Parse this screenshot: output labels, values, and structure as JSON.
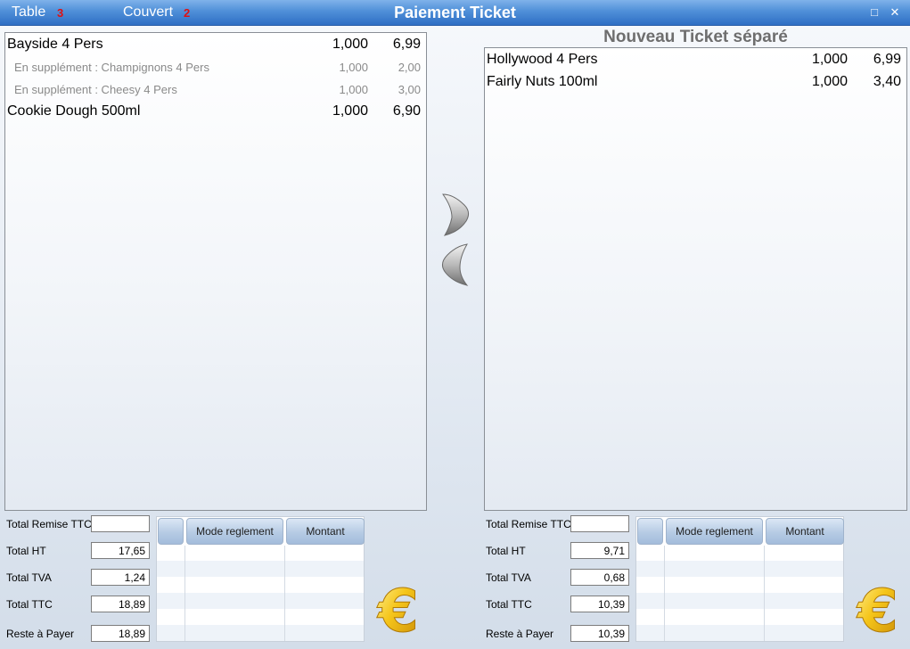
{
  "window": {
    "title": "Paiement Ticket",
    "table_label": "Table",
    "table_value": "3",
    "couvert_label": "Couvert",
    "couvert_value": "2",
    "maximize_glyph": "□",
    "close_glyph": "✕"
  },
  "left_ticket": {
    "items": [
      {
        "name": "Bayside 4 Pers",
        "qty": "1,000",
        "price": "6,99",
        "kind": "main"
      },
      {
        "name": "En supplément : Champignons 4 Pers",
        "qty": "1,000",
        "price": "2,00",
        "kind": "sub"
      },
      {
        "name": "En supplément : Cheesy 4 Pers",
        "qty": "1,000",
        "price": "3,00",
        "kind": "sub"
      },
      {
        "name": "Cookie Dough 500ml",
        "qty": "1,000",
        "price": "6,90",
        "kind": "main"
      }
    ],
    "totals": {
      "remise_label": "Total Remise TTC",
      "remise_value": "",
      "ht_label": "Total HT",
      "ht_value": "17,65",
      "tva_label": "Total TVA",
      "tva_value": "1,24",
      "ttc_label": "Total TTC",
      "ttc_value": "18,89",
      "reste_label": "Reste à Payer",
      "reste_value": "18,89"
    },
    "grid": {
      "col1": "",
      "col2": "Mode reglement",
      "col3": "Montant"
    }
  },
  "right_ticket": {
    "title": "Nouveau Ticket séparé",
    "items": [
      {
        "name": "Hollywood 4 Pers",
        "qty": "1,000",
        "price": "6,99",
        "kind": "main"
      },
      {
        "name": "Fairly Nuts 100ml",
        "qty": "1,000",
        "price": "3,40",
        "kind": "main"
      }
    ],
    "totals": {
      "remise_label": "Total Remise TTC",
      "remise_value": "",
      "ht_label": "Total HT",
      "ht_value": "9,71",
      "tva_label": "Total TVA",
      "tva_value": "0,68",
      "ttc_label": "Total TTC",
      "ttc_value": "10,39",
      "reste_label": "Reste à Payer",
      "reste_value": "10,39"
    },
    "grid": {
      "col1": "",
      "col2": "Mode reglement",
      "col3": "Montant"
    }
  },
  "icons": {
    "move_right": "chevron-right-icon",
    "move_left": "chevron-left-icon",
    "pay": "euro-icon"
  },
  "colors": {
    "titlebar": "#4f8fd8",
    "counter_red": "#e01010",
    "sub_item_gray": "#8a8a8a"
  }
}
